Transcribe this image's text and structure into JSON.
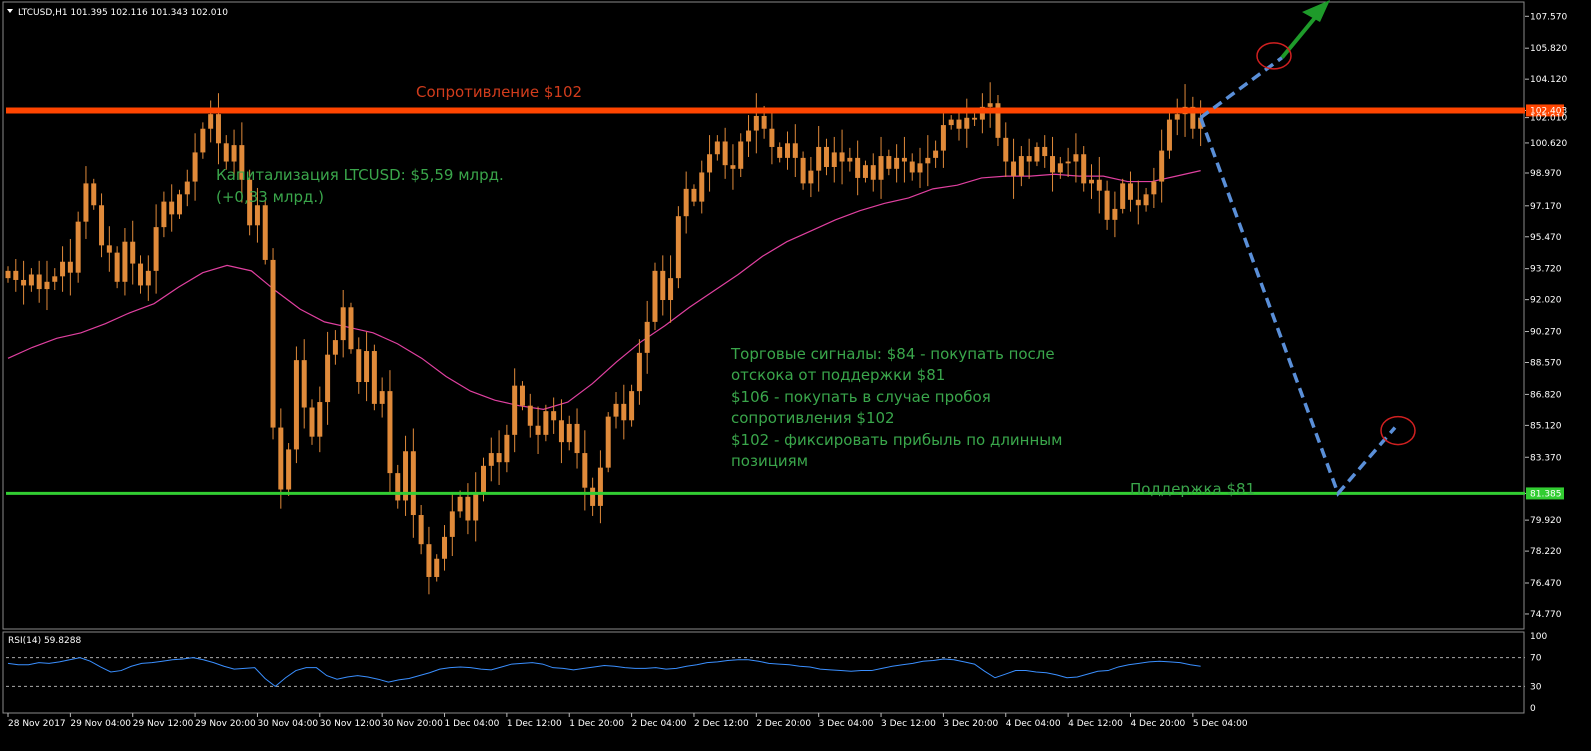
{
  "chart_data": [
    {
      "type": "candlestick",
      "header": "LTCUSD,H1  101.395 102.116 101.343 102.010",
      "y_axis_labels": [
        "107.570",
        "105.820",
        "104.120",
        "102.403",
        "102.010",
        "100.620",
        "98.970",
        "97.170",
        "95.470",
        "93.720",
        "92.020",
        "90.270",
        "88.570",
        "86.820",
        "85.120",
        "83.370",
        "81.385",
        "79.920",
        "78.220",
        "76.470",
        "74.770"
      ],
      "ylim": [
        74.0,
        108.3
      ],
      "x_axis_labels": [
        "28 Nov 2017",
        "29 Nov 04:00",
        "29 Nov 12:00",
        "29 Nov 20:00",
        "30 Nov 04:00",
        "30 Nov 12:00",
        "30 Nov 20:00",
        "1 Dec 04:00",
        "1 Dec 12:00",
        "1 Dec 20:00",
        "2 Dec 04:00",
        "2 Dec 12:00",
        "2 Dec 20:00",
        "3 Dec 04:00",
        "3 Dec 12:00",
        "3 Dec 20:00",
        "4 Dec 04:00",
        "4 Dec 12:00",
        "4 Dec 20:00",
        "5 Dec 04:00"
      ],
      "x_interval_hours": 8,
      "candles_close": [
        93.6,
        93.1,
        92.8,
        93.4,
        92.6,
        93.0,
        93.3,
        94.1,
        93.5,
        96.3,
        98.4,
        97.2,
        95.0,
        94.6,
        93.0,
        95.2,
        94.0,
        92.8,
        93.6,
        96.0,
        97.4,
        96.7,
        97.8,
        98.5,
        100.1,
        101.4,
        102.2,
        100.6,
        99.6,
        100.5,
        98.6,
        96.1,
        97.2,
        94.2,
        85.0,
        81.6,
        83.8,
        88.7,
        86.1,
        84.5,
        86.4,
        89.0,
        89.8,
        91.6,
        89.3,
        87.5,
        89.2,
        86.3,
        87.0,
        82.5,
        81.0,
        83.7,
        80.2,
        78.6,
        76.8,
        77.8,
        79.0,
        80.4,
        81.2,
        79.9,
        81.4,
        82.9,
        83.6,
        83.1,
        84.6,
        87.3,
        86.2,
        85.1,
        84.6,
        85.9,
        85.4,
        84.2,
        85.2,
        83.6,
        81.7,
        80.7,
        82.8,
        85.6,
        86.3,
        85.4,
        87.0,
        89.1,
        90.8,
        93.6,
        92.0,
        93.2,
        96.6,
        98.1,
        97.4,
        99.0,
        100.0,
        100.7,
        99.4,
        99.2,
        100.7,
        101.3,
        102.1,
        101.4,
        100.4,
        99.8,
        100.6,
        99.8,
        98.4,
        99.1,
        100.4,
        99.3,
        100.1,
        99.6,
        99.8,
        98.7,
        99.4,
        98.6,
        99.9,
        99.2,
        99.8,
        99.6,
        99.0,
        99.5,
        99.8,
        100.2,
        101.6,
        101.9,
        101.4,
        102.0,
        101.9,
        102.6,
        102.8,
        100.9,
        99.6,
        98.8,
        99.9,
        99.6,
        100.4,
        99.9,
        99.0,
        99.5,
        99.6,
        100.0,
        98.4,
        98.6,
        98.0,
        96.4,
        97.0,
        98.4,
        97.5,
        97.2,
        97.8,
        98.5,
        100.2,
        101.9,
        102.2,
        102.6,
        101.4,
        102.01
      ],
      "moving_average": [
        88.8,
        89.4,
        89.9,
        90.2,
        90.7,
        91.3,
        91.8,
        92.7,
        93.5,
        93.9,
        93.6,
        92.5,
        91.5,
        90.8,
        90.5,
        90.2,
        89.6,
        88.8,
        87.8,
        87.0,
        86.5,
        86.2,
        86.0,
        86.4,
        87.4,
        88.6,
        89.7,
        90.6,
        91.6,
        92.5,
        93.4,
        94.4,
        95.2,
        95.8,
        96.4,
        96.9,
        97.3,
        97.6,
        98.1,
        98.3,
        98.7,
        98.8,
        98.8,
        98.9,
        98.8,
        98.8,
        98.5,
        98.5,
        98.8,
        99.1
      ],
      "rsi": {
        "label": "RSI(14) 59.8288",
        "levels": [
          "100",
          "70",
          "30",
          "0"
        ],
        "values": [
          62,
          60,
          60,
          63,
          62,
          64,
          67,
          70,
          65,
          57,
          50,
          52,
          58,
          62,
          63,
          65,
          67,
          68,
          70,
          67,
          63,
          58,
          54,
          55,
          56,
          41,
          30,
          42,
          52,
          56,
          56,
          45,
          40,
          43,
          45,
          43,
          40,
          36,
          39,
          41,
          45,
          49,
          54,
          56,
          57,
          56,
          54,
          53,
          57,
          61,
          62,
          63,
          61,
          56,
          55,
          53,
          55,
          57,
          59,
          58,
          56,
          55,
          55,
          56,
          54,
          55,
          58,
          60,
          63,
          64,
          66,
          67,
          67,
          65,
          62,
          61,
          60,
          58,
          57,
          54,
          53,
          52,
          51,
          52,
          52,
          55,
          58,
          60,
          62,
          65,
          66,
          68,
          67,
          64,
          61,
          51,
          42,
          47,
          52,
          52,
          50,
          49,
          46,
          42,
          43,
          47,
          51,
          52,
          57,
          60,
          62,
          64,
          65,
          64,
          63,
          60,
          58
        ]
      }
    }
  ],
  "annotations": {
    "resistance": {
      "label": "Сопротивление $102",
      "price": "102.403",
      "color": "#ff4500"
    },
    "support": {
      "label": "Поддержка $81",
      "price": "81.385",
      "color": "#32cd32"
    },
    "capitalization": [
      "Капитализация LTCUSD: $5,59 млрд.",
      "(+0,33 млрд.)"
    ],
    "signals": [
      "Торговые сигналы: $84 - покупать после",
      "отскока от поддержки $81",
      "$106 - покупать в случае пробоя",
      "сопротивления $102",
      "$102 - фиксировать прибыль по длинным",
      "позициям"
    ]
  },
  "colors": {
    "candle": "#e08a3a",
    "ma": "#e040a0",
    "rsi": "#3a8fff",
    "text_green": "#3aa64b",
    "forecast": "#5a8fd8",
    "arrow": "#1e9b2a",
    "circle": "#d02020"
  }
}
